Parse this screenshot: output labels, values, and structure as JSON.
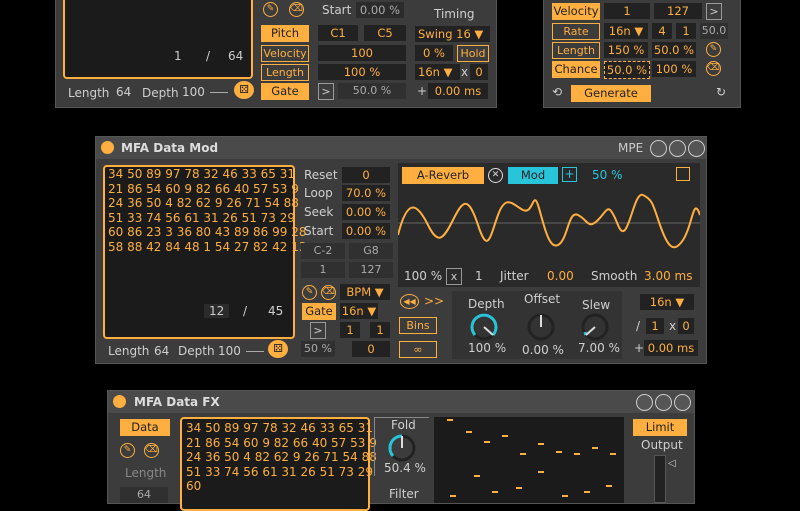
{
  "top_left": {
    "seq_pos": "1",
    "seq_sep": "/",
    "seq_len": "64",
    "length_label": "Length",
    "length_value": "64",
    "depth_label": "Depth",
    "depth_value": "100",
    "start_label": "Start",
    "start_value": "0.00 %",
    "timing_label": "Timing",
    "pitch_label": "Pitch",
    "pitch_low": "C1",
    "pitch_high": "C5",
    "velocity_label": "Velocity",
    "velocity_value": "100",
    "length_btn": "Length",
    "length_pct": "100 %",
    "gate_label": "Gate",
    "gate_arrow": ">",
    "gate_value": "50.0 %",
    "swing": "Swing 16",
    "swing_pct": "0 %",
    "hold_label": "Hold",
    "rate": "16n",
    "rate_x": "x",
    "rate_mult": "0",
    "offset_plus": "+",
    "offset_ms": "0.00 ms"
  },
  "top_right": {
    "velocity_label": "Velocity",
    "vel_low": "1",
    "vel_high": "127",
    "vel_arrow": ">",
    "rate_label": "Rate",
    "rate_val": "16n",
    "rate_a": "4",
    "rate_b": "1",
    "rate_c": "50.0",
    "length_label": "Length",
    "len_a": "150 %",
    "len_b": "50.0 %",
    "chance_label": "Chance",
    "ch_a": "50.0 %",
    "ch_b": "100 %",
    "generate_label": "Generate"
  },
  "data_mod": {
    "title": "MFA Data Mod",
    "mpe_label": "MPE",
    "seq_lines": [
      "34 50 89 97 78 32 46 33 65 31",
      "21 86 54 60 9 82 66 40 57 53 9",
      "24 36 50 4 82 62 9 26 71 54 88",
      "51 33 74 56 61 31 26 51 73 29",
      "60 86 23 3 36 80 43 89 86 99 28",
      "58 88 42 84 48 1 54 27 82 42 13"
    ],
    "seq_pos": "12",
    "seq_sep": "/",
    "seq_len": "45",
    "length_label": "Length",
    "length_value": "64",
    "depth_label": "Depth",
    "depth_value": "100",
    "reset_label": "Reset",
    "reset_value": "0",
    "loop_label": "Loop",
    "loop_value": "70.0 %",
    "seek_label": "Seek",
    "seek_value": "0.00 %",
    "start_label": "Start",
    "start_value": "0.00 %",
    "note_low": "C-2",
    "note_high": "G8",
    "num_low": "1",
    "num_high": "127",
    "bpm_label": "BPM",
    "gate_label": "Gate",
    "gate_rate": "16n",
    "gate_arrow": ">",
    "gate_a": "1",
    "gate_b": "1",
    "pct": "50 %",
    "zero": "0",
    "target_label": "A-Reverb",
    "mod_label": "Mod",
    "mod_pct": "50 %",
    "wave_scale": "100 %",
    "wave_x": "x",
    "wave_one": "1",
    "jitter_label": "Jitter",
    "jitter_value": "0.00",
    "smooth_label": "Smooth",
    "smooth_value": "3.00 ms",
    "rw_icon": "◀◀",
    "ff_icon": ">>",
    "bins_label": "Bins",
    "inf_label": "∞",
    "depth_knob_label": "Depth",
    "depth_knob_value": "100 %",
    "offset_knob_label": "Offset",
    "offset_knob_value": "0.00 %",
    "slew_knob_label": "Slew",
    "slew_knob_value": "7.00 %",
    "rate_val": "16n",
    "rate_slash": "/",
    "rate_a": "1",
    "rate_x": "x",
    "rate_b": "0",
    "offset_plus": "+",
    "offset_ms": "0.00 ms"
  },
  "data_fx": {
    "title": "MFA Data FX",
    "data_label": "Data",
    "length_label": "Length",
    "length_value": "64",
    "seq_lines": [
      "34 50 89 97 78 32 46 33 65 31",
      "21 86 54 60 9 82 66 40 57 53 9",
      "24 36 50 4 82 62 9 26 71 54 88",
      "51 33 74 56 61 31 26 51 73 29",
      "60"
    ],
    "fold_label": "Fold",
    "fold_value": "50.4 %",
    "filter_label": "Filter",
    "limit_label": "Limit",
    "output_label": "Output"
  }
}
